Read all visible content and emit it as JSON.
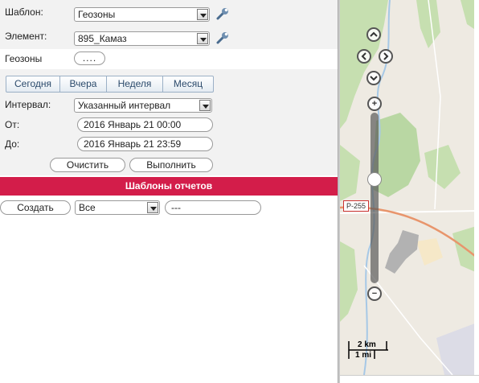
{
  "form": {
    "template_label": "Шаблон:",
    "template_value": "Геозоны",
    "element_label": "Элемент:",
    "element_value": "895_Камаз",
    "geozones_label": "Геозоны",
    "geozones_button": "....",
    "tabs": [
      "Сегодня",
      "Вчера",
      "Неделя",
      "Месяц"
    ],
    "interval_label": "Интервал:",
    "interval_value": "Указанный интервал",
    "from_label": "От:",
    "from_value": "2016 Январь 21 00:00",
    "to_label": "До:",
    "to_value": "2016 Январь 21 23:59",
    "clear_button": "Очистить",
    "run_button": "Выполнить"
  },
  "templates": {
    "header": "Шаблоны отчетов",
    "create_button": "Создать",
    "filter_value": "Все",
    "search_value": "---"
  },
  "map": {
    "road_label": "Р-255",
    "scale_km": "2 km",
    "scale_mi": "1 mi",
    "zoom_in": "+",
    "zoom_out": "−"
  },
  "colors": {
    "accent_red": "#d31d4a",
    "panel_bg": "#f2f2f2",
    "forest_green": "#b9d7a3",
    "road_orange": "#e8956c"
  }
}
